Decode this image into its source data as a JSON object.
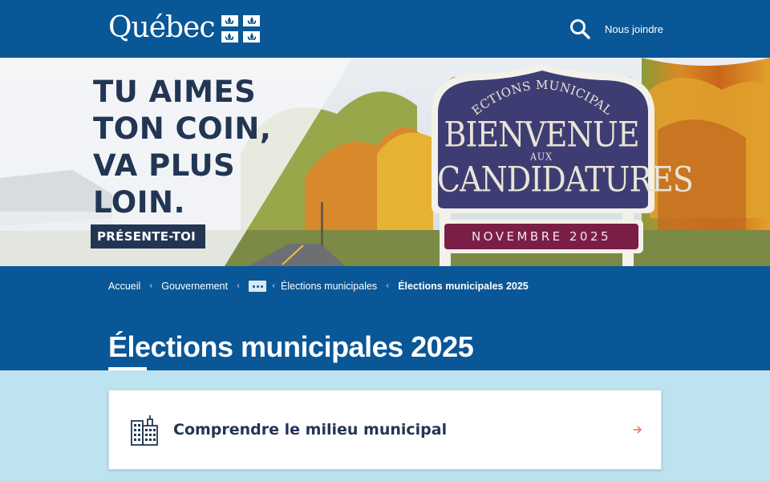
{
  "header": {
    "logo_text": "Québec",
    "contact_label": "Nous joindre"
  },
  "banner": {
    "headline": [
      "TU AIMES",
      "TON COIN,",
      "VA PLUS",
      "LOIN."
    ],
    "cta": "PRÉSENTE-TOI",
    "sign": {
      "arc_text": "ÉLECTIONS MUNICIPALES",
      "line1": "BIENVENUE",
      "aux": "AUX",
      "line2": "CANDIDATURES",
      "date": "NOVEMBRE 2025"
    }
  },
  "breadcrumb": {
    "items": [
      "Accueil",
      "Gouvernement",
      "Élections municipales",
      "Élections municipales 2025"
    ]
  },
  "page": {
    "title": "Élections municipales 2025"
  },
  "cards": [
    {
      "label": "Comprendre le milieu municipal",
      "icon": "buildings-icon"
    }
  ],
  "colors": {
    "brand_blue": "#095797",
    "dark_navy": "#223654",
    "light_blue_bg": "#bde3f1",
    "sign_purple": "#3e3d73",
    "sign_burgundy": "#7a1e48",
    "arrow": "#e58271"
  }
}
